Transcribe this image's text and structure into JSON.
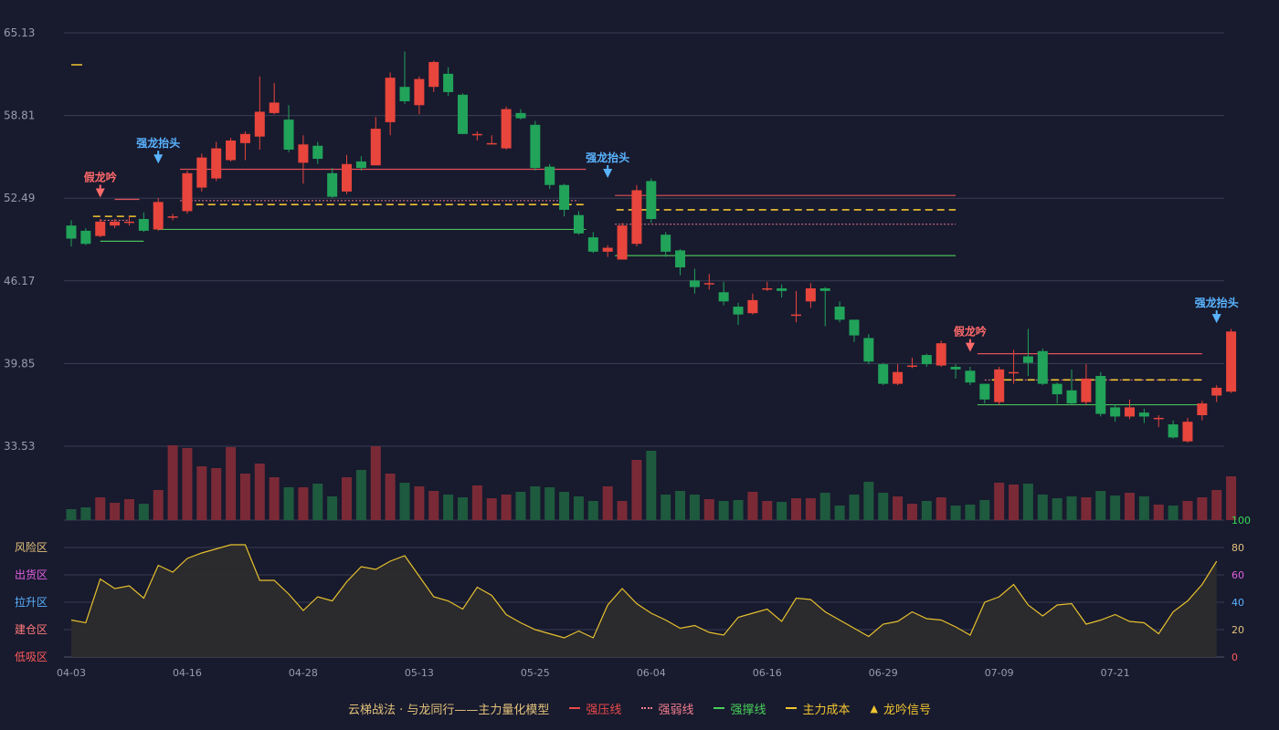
{
  "colors": {
    "up": "#e8453c",
    "down": "#21a35a",
    "grid": "#3a3d52",
    "axis_text": "#9a9cab",
    "pressure": "#e0525a",
    "weak": "#e87a8c",
    "support": "#48c05a",
    "cost": "#f2c530",
    "signal": "#f2c530",
    "osc_line": "#e6c12e",
    "strong_label": "#5ab4ff",
    "fake_label": "#ff6a6a"
  },
  "legend": {
    "title": "云梯战法 · 与龙同行——主力量化模型",
    "items": [
      {
        "label": "强压线",
        "color": "#e84a4a",
        "style": "solid"
      },
      {
        "label": "强弱线",
        "color": "#f07c8c",
        "style": "dot"
      },
      {
        "label": "强撑线",
        "color": "#48d05a",
        "style": "solid"
      },
      {
        "label": "主力成本",
        "color": "#f2c530",
        "style": "dash"
      },
      {
        "label": "龙吟信号",
        "color": "#f2c530",
        "style": "triangle"
      }
    ]
  },
  "chart_data": [
    {
      "type": "candlestick",
      "title": "",
      "y_ticks": [
        65.13,
        58.81,
        52.49,
        46.17,
        39.85,
        33.53
      ],
      "ylim": [
        33.53,
        65.13
      ],
      "x_tick_labels": [
        "04-03",
        "04-16",
        "04-28",
        "05-13",
        "05-25",
        "06-04",
        "06-16",
        "06-29",
        "07-09",
        "07-21"
      ],
      "x_tick_indices": [
        0,
        8,
        16,
        24,
        32,
        40,
        48,
        56,
        64,
        72
      ],
      "candles": [
        [
          50.4,
          49.4,
          50.8,
          48.8
        ],
        [
          50.0,
          49.0,
          50.2,
          48.9
        ],
        [
          49.6,
          50.7,
          50.9,
          49.5
        ],
        [
          50.4,
          50.7,
          50.9,
          50.2
        ],
        [
          50.6,
          50.7,
          51.1,
          50.4
        ],
        [
          50.9,
          50.0,
          51.4,
          49.9
        ],
        [
          50.1,
          52.2,
          52.5,
          50.0
        ],
        [
          51.0,
          51.1,
          51.3,
          50.8
        ],
        [
          51.5,
          54.4,
          54.6,
          51.3
        ],
        [
          53.3,
          55.6,
          55.9,
          53.0
        ],
        [
          54.0,
          56.3,
          56.8,
          53.8
        ],
        [
          55.4,
          56.9,
          57.1,
          55.3
        ],
        [
          56.7,
          57.4,
          57.6,
          55.4
        ],
        [
          57.2,
          59.1,
          61.8,
          56.2
        ],
        [
          59.0,
          59.8,
          61.3,
          58.9
        ],
        [
          58.5,
          56.2,
          59.6,
          56.0
        ],
        [
          55.2,
          56.6,
          57.3,
          53.6
        ],
        [
          56.5,
          55.5,
          56.8,
          55.1
        ],
        [
          54.4,
          52.6,
          54.8,
          52.5
        ],
        [
          53.0,
          55.1,
          55.8,
          52.8
        ],
        [
          55.3,
          54.8,
          55.7,
          54.6
        ],
        [
          55.0,
          57.8,
          58.7,
          55.0
        ],
        [
          58.3,
          61.7,
          62.1,
          57.3
        ],
        [
          61.0,
          59.9,
          63.7,
          59.7
        ],
        [
          59.6,
          61.6,
          61.8,
          58.9
        ],
        [
          61.0,
          62.9,
          63.0,
          60.6
        ],
        [
          62.0,
          60.6,
          62.5,
          60.3
        ],
        [
          60.4,
          57.4,
          60.5,
          57.4
        ],
        [
          57.4,
          57.4,
          57.6,
          56.9
        ],
        [
          56.7,
          56.7,
          57.3,
          56.7
        ],
        [
          56.3,
          59.3,
          59.5,
          56.2
        ],
        [
          59.0,
          58.6,
          59.3,
          58.5
        ],
        [
          58.1,
          54.8,
          58.4,
          54.6
        ],
        [
          54.9,
          53.5,
          55.1,
          53.2
        ],
        [
          53.5,
          51.6,
          53.6,
          51.1
        ],
        [
          51.2,
          49.8,
          51.5,
          49.7
        ],
        [
          49.5,
          48.4,
          49.9,
          48.3
        ],
        [
          48.4,
          48.7,
          48.9,
          48.0
        ],
        [
          47.8,
          50.4,
          50.6,
          47.8
        ],
        [
          49.0,
          53.1,
          53.5,
          48.8
        ],
        [
          53.8,
          50.9,
          54.0,
          50.6
        ],
        [
          49.7,
          48.4,
          49.9,
          48.0
        ],
        [
          48.5,
          47.2,
          48.6,
          46.6
        ],
        [
          46.2,
          45.7,
          47.1,
          45.2
        ],
        [
          45.9,
          46.0,
          46.7,
          45.5
        ],
        [
          45.3,
          44.6,
          46.1,
          44.3
        ],
        [
          44.2,
          43.6,
          44.5,
          42.8
        ],
        [
          43.7,
          44.7,
          45.2,
          43.6
        ],
        [
          45.5,
          45.6,
          46.1,
          45.4
        ],
        [
          45.6,
          45.4,
          45.9,
          44.9
        ],
        [
          43.6,
          43.6,
          45.4,
          43.0
        ],
        [
          44.6,
          45.6,
          46.0,
          44.1
        ],
        [
          45.6,
          45.4,
          45.7,
          42.7
        ],
        [
          44.2,
          43.2,
          44.6,
          43.0
        ],
        [
          43.2,
          42.0,
          43.2,
          41.5
        ],
        [
          41.8,
          40.0,
          42.1,
          39.8
        ],
        [
          39.8,
          38.3,
          39.9,
          38.2
        ],
        [
          38.3,
          39.2,
          39.8,
          38.2
        ],
        [
          39.7,
          39.7,
          40.3,
          39.5
        ],
        [
          40.5,
          39.8,
          40.6,
          39.6
        ],
        [
          39.7,
          41.4,
          41.6,
          39.6
        ],
        [
          39.6,
          39.4,
          39.8,
          38.7
        ],
        [
          39.3,
          38.4,
          39.6,
          38.2
        ],
        [
          38.3,
          37.1,
          38.3,
          36.8
        ],
        [
          36.9,
          39.4,
          39.6,
          36.7
        ],
        [
          39.1,
          39.2,
          40.9,
          38.3
        ],
        [
          40.4,
          39.9,
          42.5,
          38.9
        ],
        [
          40.8,
          38.3,
          41.0,
          38.2
        ],
        [
          38.3,
          37.5,
          38.4,
          36.8
        ],
        [
          37.8,
          36.8,
          39.4,
          36.7
        ],
        [
          36.9,
          38.7,
          39.8,
          36.7
        ],
        [
          38.9,
          36.0,
          39.2,
          35.8
        ],
        [
          36.5,
          35.8,
          36.7,
          35.4
        ],
        [
          35.8,
          36.5,
          37.1,
          35.6
        ],
        [
          36.1,
          35.8,
          36.4,
          35.3
        ],
        [
          35.7,
          35.7,
          35.9,
          35.0
        ],
        [
          35.2,
          34.2,
          35.5,
          34.1
        ],
        [
          33.9,
          35.4,
          35.7,
          33.8
        ],
        [
          35.9,
          36.8,
          37.0,
          35.5
        ],
        [
          37.4,
          38.0,
          38.2,
          36.9
        ],
        [
          37.7,
          42.3,
          42.5,
          37.6
        ]
      ],
      "lines": {
        "pressure": [
          [
            3,
            4.7,
            52.4
          ],
          [
            7.5,
            35.5,
            54.7
          ],
          [
            37.5,
            61,
            52.7
          ],
          [
            62.5,
            78,
            40.6
          ]
        ],
        "weak": [
          [
            2,
            4,
            50.8
          ],
          [
            7.5,
            35,
            52.3
          ],
          [
            37.5,
            61,
            50.5
          ],
          [
            63,
            78,
            38.6
          ]
        ],
        "cost": [
          [
            1.5,
            4.5,
            51.1
          ],
          [
            7.8,
            35.5,
            52.0
          ],
          [
            37.6,
            61,
            51.6
          ],
          [
            63.5,
            78,
            38.6
          ]
        ],
        "support": [
          [
            2,
            5,
            49.2
          ],
          [
            6,
            35.5,
            50.1
          ],
          [
            37.5,
            61,
            48.1
          ],
          [
            62.5,
            78,
            36.7
          ]
        ]
      },
      "labels": [
        {
          "text": "假龙吟",
          "i": 2,
          "kind": "fake",
          "price": 52.4
        },
        {
          "text": "强龙抬头",
          "i": 6,
          "kind": "strong",
          "price": 55.0
        },
        {
          "text": "强龙抬头",
          "i": 37,
          "kind": "strong",
          "price": 53.9
        },
        {
          "text": "假龙吟",
          "i": 62,
          "kind": "fake",
          "price": 40.6
        },
        {
          "text": "强龙抬头",
          "i": 79,
          "kind": "strong",
          "price": 42.8
        }
      ]
    },
    {
      "type": "bar",
      "title": "",
      "volume": [
        12,
        14,
        25,
        19,
        23,
        18,
        33,
        82,
        79,
        59,
        57,
        80,
        51,
        62,
        47,
        36,
        36,
        40,
        26,
        47,
        55,
        81,
        51,
        41,
        37,
        32,
        28,
        25,
        38,
        24,
        28,
        31,
        37,
        36,
        31,
        26,
        21,
        37,
        21,
        66,
        76,
        28,
        32,
        28,
        23,
        21,
        22,
        31,
        21,
        20,
        24,
        24,
        30,
        16,
        28,
        42,
        30,
        26,
        18,
        21,
        25,
        16,
        17,
        22,
        41,
        39,
        40,
        28,
        24,
        26,
        25,
        32,
        27,
        30,
        26,
        17,
        16,
        21,
        25,
        33,
        48
      ]
    },
    {
      "type": "area",
      "title": "",
      "ylim": [
        0,
        100
      ],
      "right_ticks": [
        {
          "v": 100,
          "label": "100",
          "color": "#33dd55"
        },
        {
          "v": 80,
          "label": "80",
          "color": "#e2c27a"
        },
        {
          "v": 60,
          "label": "60",
          "color": "#e060e0"
        },
        {
          "v": 40,
          "label": "40",
          "color": "#5ab4ff"
        },
        {
          "v": 20,
          "label": "20",
          "color": "#e2c27a"
        },
        {
          "v": 0,
          "label": "0",
          "color": "#ff5a5a"
        }
      ],
      "left_zones": [
        {
          "v": 80,
          "label": "风险区",
          "color": "#e2c27a"
        },
        {
          "v": 60,
          "label": "出货区",
          "color": "#e060e0"
        },
        {
          "v": 40,
          "label": "拉升区",
          "color": "#5ab4ff"
        },
        {
          "v": 20,
          "label": "建仓区",
          "color": "#ff7a7a"
        },
        {
          "v": 0,
          "label": "低吸区",
          "color": "#ff5a5a"
        }
      ],
      "values": [
        27,
        25,
        57,
        50,
        52,
        43,
        67,
        62,
        72,
        76,
        79,
        82,
        82,
        56,
        56,
        46,
        34,
        44,
        41,
        55,
        66,
        64,
        70,
        74,
        59,
        44,
        41,
        35,
        51,
        45,
        31,
        25,
        20,
        17,
        14,
        19,
        14,
        38,
        50,
        39,
        32,
        27,
        21,
        23,
        18,
        16,
        29,
        32,
        35,
        26,
        43,
        42,
        33,
        27,
        21,
        15,
        24,
        26,
        33,
        28,
        27,
        22,
        16,
        40,
        44,
        53,
        38,
        30,
        38,
        39,
        24,
        27,
        31,
        26,
        25,
        17,
        33,
        41,
        53,
        70
      ]
    }
  ]
}
